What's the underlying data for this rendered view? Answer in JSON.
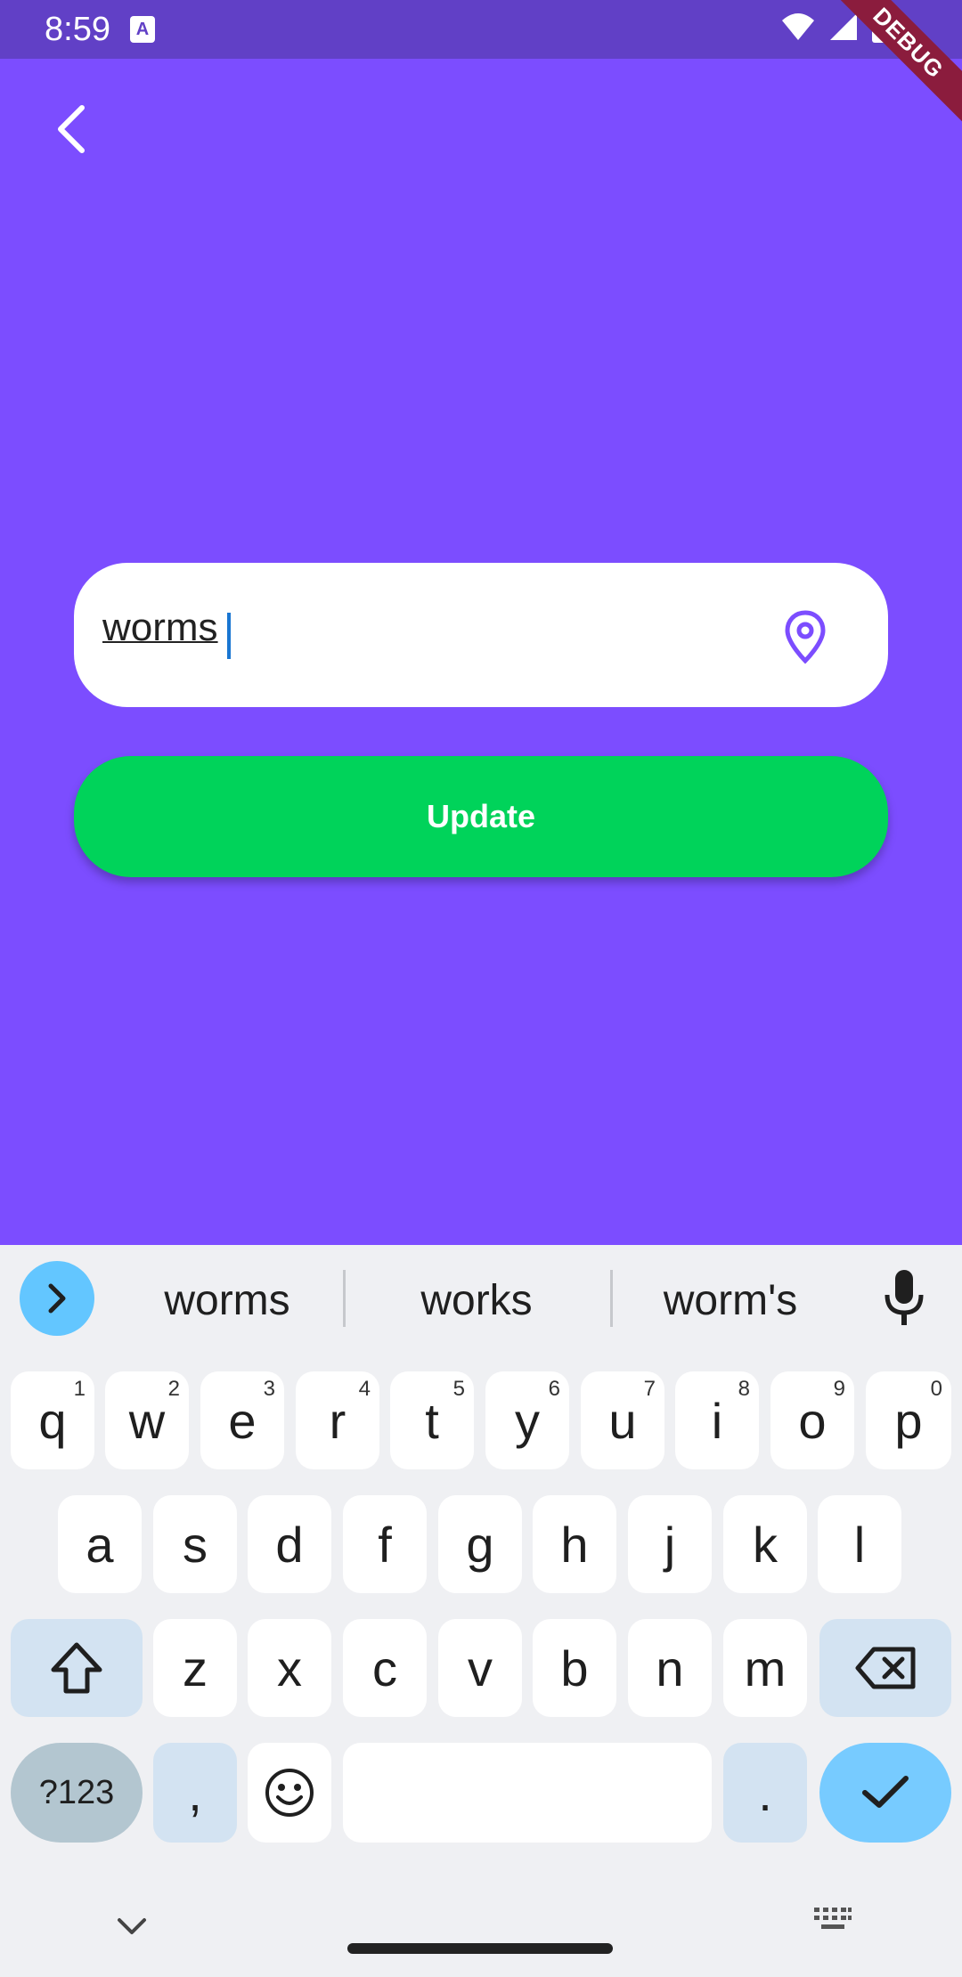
{
  "status_bar": {
    "time": "8:59",
    "app_badge": "A",
    "icons": [
      "wifi-icon",
      "cell-signal-icon",
      "battery-icon"
    ],
    "debug_label": "DEBUG"
  },
  "screen": {
    "city_input": {
      "value": "worms",
      "icon": "location-pin-icon"
    },
    "update_button": {
      "label": "Update"
    }
  },
  "colors": {
    "background": "#7c4dff",
    "status_bar": "#6140c6",
    "update": "#00d35a",
    "pin": "#7c4dff"
  },
  "keyboard": {
    "suggestions": [
      "worms",
      "works",
      "worm's"
    ],
    "row1": [
      {
        "k": "q",
        "s": "1"
      },
      {
        "k": "w",
        "s": "2"
      },
      {
        "k": "e",
        "s": "3"
      },
      {
        "k": "r",
        "s": "4"
      },
      {
        "k": "t",
        "s": "5"
      },
      {
        "k": "y",
        "s": "6"
      },
      {
        "k": "u",
        "s": "7"
      },
      {
        "k": "i",
        "s": "8"
      },
      {
        "k": "o",
        "s": "9"
      },
      {
        "k": "p",
        "s": "0"
      }
    ],
    "row2": [
      "a",
      "s",
      "d",
      "f",
      "g",
      "h",
      "j",
      "k",
      "l"
    ],
    "row3": [
      "z",
      "x",
      "c",
      "v",
      "b",
      "n",
      "m"
    ],
    "sym_label": "?123",
    "comma": ",",
    "period": "."
  }
}
